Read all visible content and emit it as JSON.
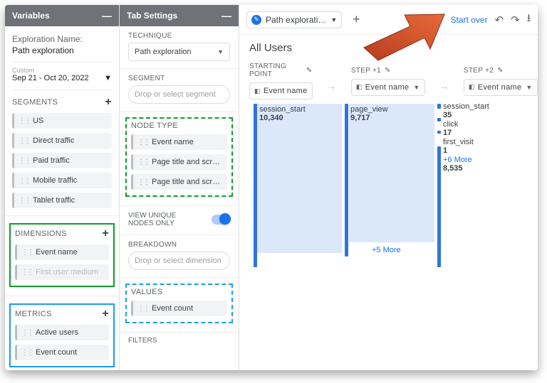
{
  "variables_panel": {
    "title": "Variables",
    "exploration_label": "Exploration Name:",
    "exploration_value": "Path exploration",
    "custom_label": "Custom",
    "date_range": "Sep 21 - Oct 20, 2022",
    "segments": {
      "title": "SEGMENTS",
      "items": [
        "US",
        "Direct traffic",
        "Paid traffic",
        "Mobile traffic",
        "Tablet traffic"
      ]
    },
    "dimensions": {
      "title": "DIMENSIONS",
      "items": [
        "Event name",
        "First user medium"
      ]
    },
    "metrics": {
      "title": "METRICS",
      "items": [
        "Active users",
        "Event count"
      ]
    }
  },
  "tab_settings": {
    "title": "Tab Settings",
    "technique_label": "TECHNIQUE",
    "technique_value": "Path exploration",
    "segment_label": "SEGMENT",
    "segment_drop": "Drop or select segment",
    "node_type_label": "NODE TYPE",
    "node_type_items": [
      "Event name",
      "Page title and scree…",
      "Page title and scree…"
    ],
    "unique_label": "VIEW UNIQUE NODES ONLY",
    "breakdown_label": "BREAKDOWN",
    "breakdown_drop": "Drop or select dimension",
    "values_label": "VALUES",
    "values_items": [
      "Event count"
    ],
    "filters_label": "FILTERS"
  },
  "main": {
    "tab_name": "Path explorati…",
    "start_over": "Start over",
    "all_users": "All Users",
    "starting_point": "STARTING POINT",
    "step_plus1": "STEP +1",
    "step_plus2": "STEP +2",
    "pill_event": "Event name",
    "nodes0": {
      "name": "session_start",
      "count": "10,340"
    },
    "nodes1": {
      "name": "page_view",
      "count": "9,717",
      "more": "+5 More"
    },
    "nodes2": [
      {
        "name": "session_start",
        "count": "35"
      },
      {
        "name": "click",
        "count": "17"
      },
      {
        "name": "first_visit",
        "count": "1"
      },
      {
        "more": "+6 More",
        "count": "8,535"
      }
    ]
  }
}
